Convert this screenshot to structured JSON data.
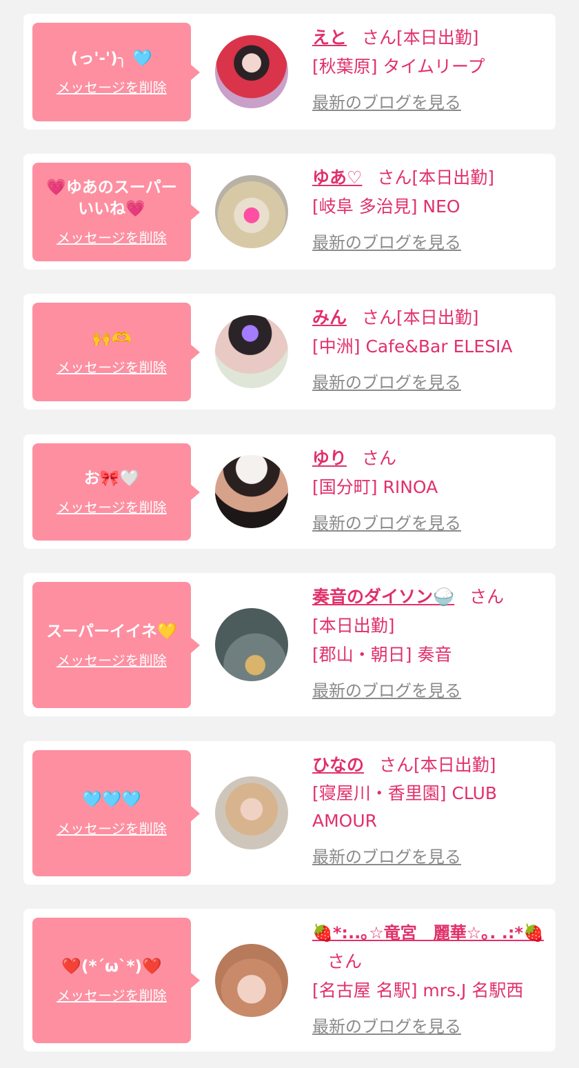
{
  "colors": {
    "accent": "#e0306a",
    "bubble": "#fd8fa1",
    "link_gray": "#8a8a8a",
    "background": "#f2f2f2"
  },
  "common": {
    "delete_label": "メッセージを削除",
    "blog_label": "最新のブログを見る",
    "san": "さん"
  },
  "items": [
    {
      "message": "(っ'-')╮ 🩵",
      "name": "えと",
      "status": "[本日出勤]",
      "shop": "[秋葉原] タイムリープ"
    },
    {
      "message": "💗ゆあのスーパーいいね💗",
      "name": "ゆあ♡",
      "status": "[本日出勤]",
      "shop": "[岐阜 多治見] NEO"
    },
    {
      "message": "🙌🫶",
      "name": "みん",
      "status": "[本日出勤]",
      "shop": "[中洲] Cafe&Bar ELESIA"
    },
    {
      "message": "お🎀🤍",
      "name": "ゆり",
      "status": "",
      "shop": "[国分町] RINOA"
    },
    {
      "message": "スーパーイイネ💛",
      "name": "奏音のダイソン🍚",
      "status": "[本日出勤]",
      "shop": "[郡山・朝日] 奏音"
    },
    {
      "message": "🩵🩵🩵",
      "name": "ひなの",
      "status": "[本日出勤]",
      "shop": "[寝屋川・香里園] CLUB AMOUR"
    },
    {
      "message": "❤️(*´ω`*)❤️",
      "name": "🍓*:..｡☆竜宮　麗華☆｡. .:*🍓",
      "status": "",
      "shop": "[名古屋 名駅] mrs.J 名駅西"
    }
  ]
}
